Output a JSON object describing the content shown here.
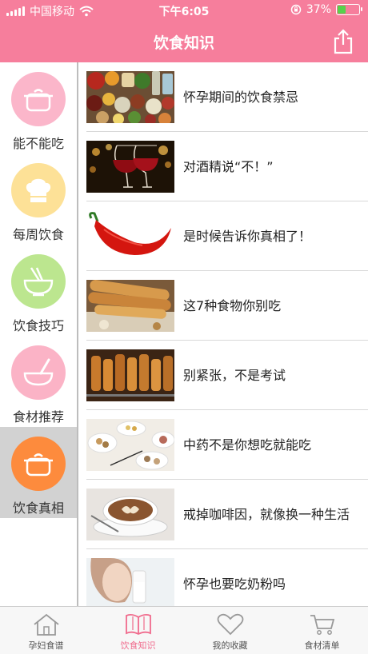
{
  "status_bar": {
    "carrier": "中国移动",
    "time": "下午6:05",
    "battery_percent": "37%",
    "battery_level": 0.37
  },
  "nav": {
    "title": "饮食知识",
    "share_icon": "share-icon"
  },
  "sidebar": {
    "items": [
      {
        "label": "能不能吃",
        "icon": "pot-icon",
        "color": "#fbb6ca",
        "active": false
      },
      {
        "label": "每周饮食",
        "icon": "chef-hat-icon",
        "color": "#fde197",
        "active": false
      },
      {
        "label": "饮食技巧",
        "icon": "noodle-bowl-icon",
        "color": "#bce68f",
        "active": false
      },
      {
        "label": "食材推荐",
        "icon": "mixing-bowl-icon",
        "color": "#fbb3c6",
        "active": false
      },
      {
        "label": "饮食真相",
        "icon": "pot-icon",
        "color": "#fd8b3d",
        "active": true
      }
    ]
  },
  "articles": [
    {
      "title": "怀孕期间的饮食禁忌",
      "image": "assorted-foods"
    },
    {
      "title": "对酒精说“不！”",
      "image": "red-wine-glasses"
    },
    {
      "title": "是时候告诉你真相了！",
      "image": "red-chili-pepper"
    },
    {
      "title": "这7种食物你别吃",
      "image": "fried-dough-sticks"
    },
    {
      "title": "别紧张，不是考试",
      "image": "grilled-skewers"
    },
    {
      "title": "中药不是你想吃就能吃",
      "image": "herbal-medicine-bowls"
    },
    {
      "title": "戒掉咖啡因，就像换一种生活",
      "image": "latte-art-cup"
    },
    {
      "title": "怀孕也要吃奶粉吗",
      "image": "woman-drinking-milk"
    }
  ],
  "tabs": [
    {
      "label": "孕妇食谱",
      "icon": "house-icon",
      "active": false
    },
    {
      "label": "饮食知识",
      "icon": "book-icon",
      "active": true
    },
    {
      "label": "我的收藏",
      "icon": "heart-icon",
      "active": false
    },
    {
      "label": "食材清单",
      "icon": "cart-icon",
      "active": false
    }
  ],
  "colors": {
    "brand_pink": "#f67e9c",
    "active_tab": "#f06a8c",
    "battery_green": "#57d14c"
  }
}
